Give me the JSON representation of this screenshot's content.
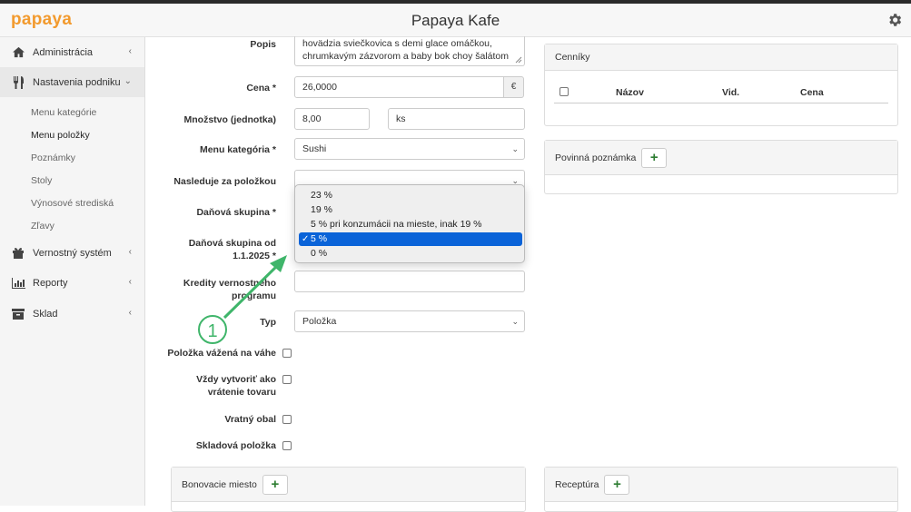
{
  "app": {
    "title": "Papaya Kafe",
    "logo_text": "papaya"
  },
  "sidebar": {
    "items": [
      {
        "label": "Administrácia"
      },
      {
        "label": "Nastavenia podniku"
      },
      {
        "label": "Vernostný systém"
      },
      {
        "label": "Reporty"
      },
      {
        "label": "Sklad"
      }
    ],
    "subitems": [
      {
        "label": "Menu kategórie"
      },
      {
        "label": "Menu položky"
      },
      {
        "label": "Poznámky"
      },
      {
        "label": "Stoly"
      },
      {
        "label": "Výnosové strediská"
      },
      {
        "label": "Zľavy"
      }
    ]
  },
  "form": {
    "popis_label": "Popis",
    "popis_value_line1": "hovädzia sviečkovica s demi glace omáčkou,",
    "popis_value_line2": "chrumkavým zázvorom a baby bok choy šalátom",
    "cena_label": "Cena *",
    "cena_value": "26,0000",
    "cena_currency": "€",
    "mnozstvo_label": "Množstvo (jednotka)",
    "mnozstvo_value": "8,00",
    "jednotka_value": "ks",
    "kategoria_label": "Menu kategória *",
    "kategoria_value": "Sushi",
    "nasleduje_label": "Nasleduje za položkou",
    "nasleduje_value": "",
    "danova_label": "Daňová skupina *",
    "danova_od_label_line1": "Daňová skupina od",
    "danova_od_label_line2": "1.1.2025 *",
    "kredity_label_line1": "Kredity vernostného",
    "kredity_label_line2": "programu",
    "kredity_value": "",
    "typ_label": "Typ",
    "typ_value": "Položka",
    "vazena_label": "Položka vážená na váhe",
    "vratenie_label_line1": "Vždy vytvoriť ako",
    "vratenie_label_line2": "vrátenie tovaru",
    "vratny_obal_label": "Vratný obal",
    "skladova_label": "Skladová položka"
  },
  "tax_dropdown": {
    "options": [
      {
        "label": "23 %",
        "selected": false
      },
      {
        "label": "19 %",
        "selected": false
      },
      {
        "label": "5 % pri konzumácii na mieste, inak 19 %",
        "selected": false
      },
      {
        "label": "5 %",
        "selected": true
      },
      {
        "label": "0 %",
        "selected": false
      }
    ],
    "check_glyph": "✓"
  },
  "panels": {
    "cenniky": {
      "title": "Cenníky",
      "columns": [
        "Názov",
        "Vid.",
        "Cena"
      ]
    },
    "poznamka": {
      "title": "Povinná poznámka"
    },
    "bonovacie": {
      "title": "Bonovacie miesto"
    },
    "receptura": {
      "title": "Receptúra"
    }
  },
  "annotation": {
    "number": "1",
    "color": "#3fb56a"
  },
  "colors": {
    "accent": "#f29a2e",
    "selection": "#0a63d8",
    "plus": "#2e7d32"
  }
}
